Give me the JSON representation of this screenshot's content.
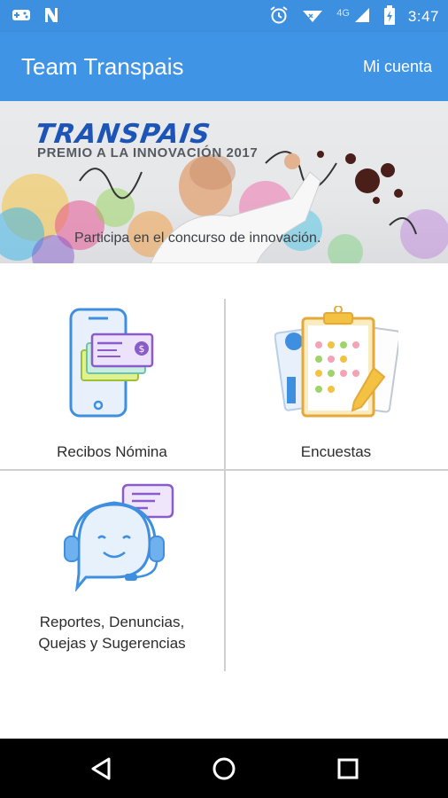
{
  "status_bar": {
    "time": "3:47",
    "network": "4G",
    "icons": [
      "game-controller-icon",
      "n-icon",
      "alarm-icon",
      "signal-icon",
      "battery-icon"
    ]
  },
  "app_bar": {
    "title": "Team Transpais",
    "account_label": "Mi cuenta"
  },
  "banner": {
    "brand": "TRANSPAIS",
    "award": "PREMIO A LA INNOVACIÓN 2017",
    "caption": "Participa en el concurso de innovación."
  },
  "menu": [
    {
      "label": "Recibos Nómina",
      "icon": "phone-receipt-icon"
    },
    {
      "label": "Encuestas",
      "icon": "clipboard-survey-icon"
    },
    {
      "label_line1": "Reportes, Denuncias,",
      "label_line2": "Quejas y Sugerencias",
      "icon": "support-headset-icon"
    }
  ],
  "nav": {
    "buttons": [
      "back-icon",
      "home-icon",
      "recents-icon"
    ]
  },
  "colors": {
    "primary": "#3f94e6",
    "status": "#3d8fe0",
    "accent_purple": "#8a5cc9",
    "accent_blue": "#3f8fe0"
  }
}
